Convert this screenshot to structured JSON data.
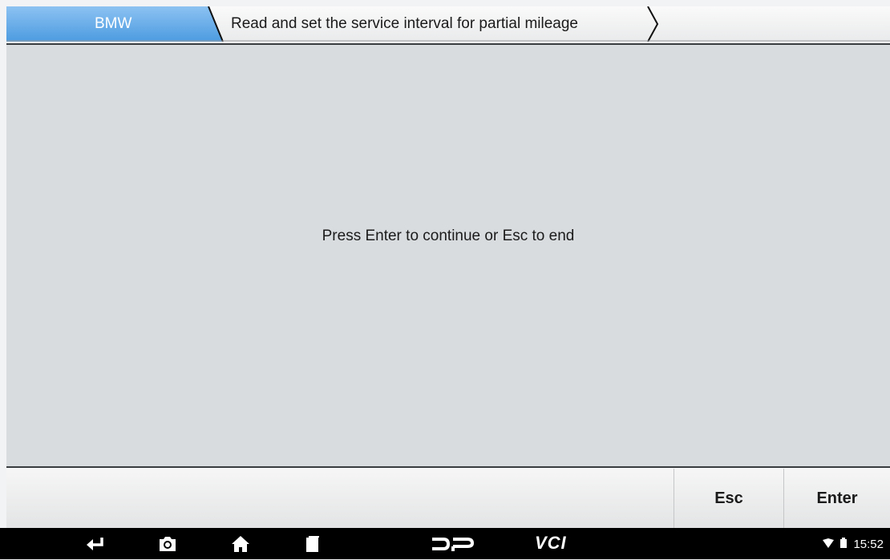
{
  "breadcrumb": {
    "make": "BMW",
    "function": "Read and set the service interval for partial mileage"
  },
  "main": {
    "message": "Press Enter to continue or Esc to end"
  },
  "buttons": {
    "esc_label": "Esc",
    "enter_label": "Enter"
  },
  "navbar": {
    "vci_label": "VCI",
    "time": "15:52",
    "icons": [
      "back-icon",
      "camera-icon",
      "home-icon",
      "recent-apps-icon",
      "dp-icon",
      "vci-icon",
      "wifi-icon",
      "battery-icon"
    ]
  },
  "colors": {
    "tab_active": "#5fa9e8",
    "content_bg": "#d8dcdf",
    "navbar_bg": "#000000"
  }
}
